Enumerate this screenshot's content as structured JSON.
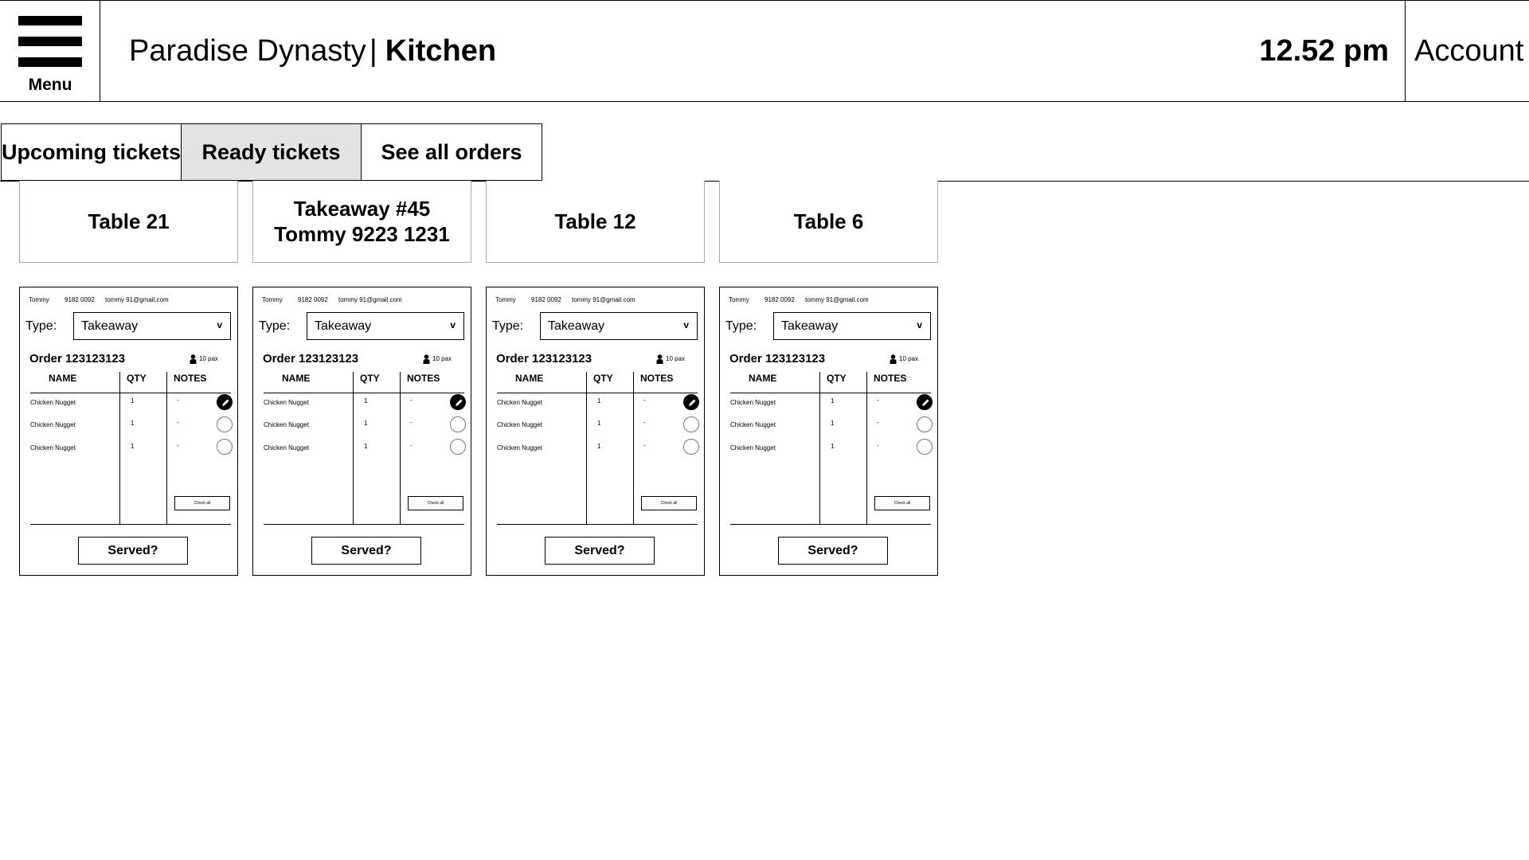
{
  "header": {
    "menu_label": "Menu",
    "restaurant_name": "Paradise Dynasty",
    "separator": "|",
    "section_name": "Kitchen",
    "clock": "12.52 pm",
    "account_label": "Account"
  },
  "tabs": [
    {
      "label": "Upcoming tickets",
      "active": false
    },
    {
      "label": "Ready tickets",
      "active": true
    },
    {
      "label": "See all orders",
      "active": false
    }
  ],
  "tickets": [
    {
      "tab_lines": [
        "Table 21"
      ],
      "contact": {
        "name": "Tommy",
        "phone": "9182 0092",
        "email": "tommy 91@gmail.com"
      },
      "type_label": "Type:",
      "type_value": "Takeaway",
      "type_caret": "v",
      "order_title": "Order 123123123",
      "pax": "10 pax",
      "columns": [
        "NAME",
        "QTY",
        "NOTES"
      ],
      "items": [
        {
          "name": "Chicken Nugget",
          "qty": "1",
          "notes": "-",
          "state": "editing"
        },
        {
          "name": "Chicken Nugget",
          "qty": "1",
          "notes": "-",
          "state": "unchecked"
        },
        {
          "name": "Chicken Nugget",
          "qty": "1",
          "notes": "-",
          "state": "unchecked"
        }
      ],
      "check_all_label": "Check all",
      "served_label": "Served?"
    },
    {
      "tab_lines": [
        "Takeaway #45",
        "Tommy 9223 1231"
      ],
      "contact": {
        "name": "Tommy",
        "phone": "9182 0092",
        "email": "tommy 91@gmail.com"
      },
      "type_label": "Type:",
      "type_value": "Takeaway",
      "type_caret": "v",
      "order_title": "Order 123123123",
      "pax": "10 pax",
      "columns": [
        "NAME",
        "QTY",
        "NOTES"
      ],
      "items": [
        {
          "name": "Chicken Nugget",
          "qty": "1",
          "notes": "-",
          "state": "editing"
        },
        {
          "name": "Chicken Nugget",
          "qty": "1",
          "notes": "-",
          "state": "unchecked"
        },
        {
          "name": "Chicken Nugget",
          "qty": "1",
          "notes": "-",
          "state": "unchecked"
        }
      ],
      "check_all_label": "Check all",
      "served_label": "Served?"
    },
    {
      "tab_lines": [
        "Table 12"
      ],
      "contact": {
        "name": "Tommy",
        "phone": "9182 0092",
        "email": "tommy 91@gmail.com"
      },
      "type_label": "Type:",
      "type_value": "Takeaway",
      "type_caret": "v",
      "order_title": "Order 123123123",
      "pax": "10 pax",
      "columns": [
        "NAME",
        "QTY",
        "NOTES"
      ],
      "items": [
        {
          "name": "Chicken Nugget",
          "qty": "1",
          "notes": "-",
          "state": "editing"
        },
        {
          "name": "Chicken Nugget",
          "qty": "1",
          "notes": "-",
          "state": "unchecked"
        },
        {
          "name": "Chicken Nugget",
          "qty": "1",
          "notes": "-",
          "state": "unchecked"
        }
      ],
      "check_all_label": "Check all",
      "served_label": "Served?"
    },
    {
      "tab_lines": [
        "Table 6"
      ],
      "contact": {
        "name": "Tommy",
        "phone": "9182 0092",
        "email": "tommy 91@gmail.com"
      },
      "type_label": "Type:",
      "type_value": "Takeaway",
      "type_caret": "v",
      "order_title": "Order 123123123",
      "pax": "10 pax",
      "columns": [
        "NAME",
        "QTY",
        "NOTES"
      ],
      "items": [
        {
          "name": "Chicken Nugget",
          "qty": "1",
          "notes": "-",
          "state": "editing"
        },
        {
          "name": "Chicken Nugget",
          "qty": "1",
          "notes": "-",
          "state": "unchecked"
        },
        {
          "name": "Chicken Nugget",
          "qty": "1",
          "notes": "-",
          "state": "unchecked"
        }
      ],
      "check_all_label": "Check all",
      "served_label": "Served?"
    }
  ]
}
